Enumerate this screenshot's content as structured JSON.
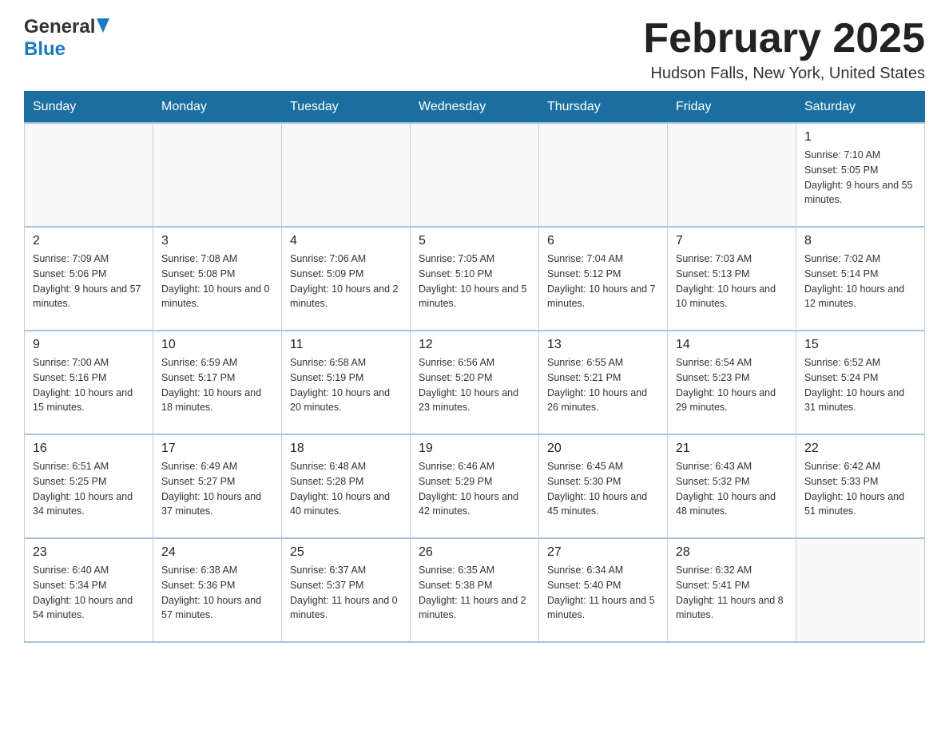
{
  "logo": {
    "general": "General",
    "blue": "Blue"
  },
  "title": "February 2025",
  "location": "Hudson Falls, New York, United States",
  "days_of_week": [
    "Sunday",
    "Monday",
    "Tuesday",
    "Wednesday",
    "Thursday",
    "Friday",
    "Saturday"
  ],
  "weeks": [
    [
      {
        "day": "",
        "info": ""
      },
      {
        "day": "",
        "info": ""
      },
      {
        "day": "",
        "info": ""
      },
      {
        "day": "",
        "info": ""
      },
      {
        "day": "",
        "info": ""
      },
      {
        "day": "",
        "info": ""
      },
      {
        "day": "1",
        "info": "Sunrise: 7:10 AM\nSunset: 5:05 PM\nDaylight: 9 hours and 55 minutes."
      }
    ],
    [
      {
        "day": "2",
        "info": "Sunrise: 7:09 AM\nSunset: 5:06 PM\nDaylight: 9 hours and 57 minutes."
      },
      {
        "day": "3",
        "info": "Sunrise: 7:08 AM\nSunset: 5:08 PM\nDaylight: 10 hours and 0 minutes."
      },
      {
        "day": "4",
        "info": "Sunrise: 7:06 AM\nSunset: 5:09 PM\nDaylight: 10 hours and 2 minutes."
      },
      {
        "day": "5",
        "info": "Sunrise: 7:05 AM\nSunset: 5:10 PM\nDaylight: 10 hours and 5 minutes."
      },
      {
        "day": "6",
        "info": "Sunrise: 7:04 AM\nSunset: 5:12 PM\nDaylight: 10 hours and 7 minutes."
      },
      {
        "day": "7",
        "info": "Sunrise: 7:03 AM\nSunset: 5:13 PM\nDaylight: 10 hours and 10 minutes."
      },
      {
        "day": "8",
        "info": "Sunrise: 7:02 AM\nSunset: 5:14 PM\nDaylight: 10 hours and 12 minutes."
      }
    ],
    [
      {
        "day": "9",
        "info": "Sunrise: 7:00 AM\nSunset: 5:16 PM\nDaylight: 10 hours and 15 minutes."
      },
      {
        "day": "10",
        "info": "Sunrise: 6:59 AM\nSunset: 5:17 PM\nDaylight: 10 hours and 18 minutes."
      },
      {
        "day": "11",
        "info": "Sunrise: 6:58 AM\nSunset: 5:19 PM\nDaylight: 10 hours and 20 minutes."
      },
      {
        "day": "12",
        "info": "Sunrise: 6:56 AM\nSunset: 5:20 PM\nDaylight: 10 hours and 23 minutes."
      },
      {
        "day": "13",
        "info": "Sunrise: 6:55 AM\nSunset: 5:21 PM\nDaylight: 10 hours and 26 minutes."
      },
      {
        "day": "14",
        "info": "Sunrise: 6:54 AM\nSunset: 5:23 PM\nDaylight: 10 hours and 29 minutes."
      },
      {
        "day": "15",
        "info": "Sunrise: 6:52 AM\nSunset: 5:24 PM\nDaylight: 10 hours and 31 minutes."
      }
    ],
    [
      {
        "day": "16",
        "info": "Sunrise: 6:51 AM\nSunset: 5:25 PM\nDaylight: 10 hours and 34 minutes."
      },
      {
        "day": "17",
        "info": "Sunrise: 6:49 AM\nSunset: 5:27 PM\nDaylight: 10 hours and 37 minutes."
      },
      {
        "day": "18",
        "info": "Sunrise: 6:48 AM\nSunset: 5:28 PM\nDaylight: 10 hours and 40 minutes."
      },
      {
        "day": "19",
        "info": "Sunrise: 6:46 AM\nSunset: 5:29 PM\nDaylight: 10 hours and 42 minutes."
      },
      {
        "day": "20",
        "info": "Sunrise: 6:45 AM\nSunset: 5:30 PM\nDaylight: 10 hours and 45 minutes."
      },
      {
        "day": "21",
        "info": "Sunrise: 6:43 AM\nSunset: 5:32 PM\nDaylight: 10 hours and 48 minutes."
      },
      {
        "day": "22",
        "info": "Sunrise: 6:42 AM\nSunset: 5:33 PM\nDaylight: 10 hours and 51 minutes."
      }
    ],
    [
      {
        "day": "23",
        "info": "Sunrise: 6:40 AM\nSunset: 5:34 PM\nDaylight: 10 hours and 54 minutes."
      },
      {
        "day": "24",
        "info": "Sunrise: 6:38 AM\nSunset: 5:36 PM\nDaylight: 10 hours and 57 minutes."
      },
      {
        "day": "25",
        "info": "Sunrise: 6:37 AM\nSunset: 5:37 PM\nDaylight: 11 hours and 0 minutes."
      },
      {
        "day": "26",
        "info": "Sunrise: 6:35 AM\nSunset: 5:38 PM\nDaylight: 11 hours and 2 minutes."
      },
      {
        "day": "27",
        "info": "Sunrise: 6:34 AM\nSunset: 5:40 PM\nDaylight: 11 hours and 5 minutes."
      },
      {
        "day": "28",
        "info": "Sunrise: 6:32 AM\nSunset: 5:41 PM\nDaylight: 11 hours and 8 minutes."
      },
      {
        "day": "",
        "info": ""
      }
    ]
  ]
}
